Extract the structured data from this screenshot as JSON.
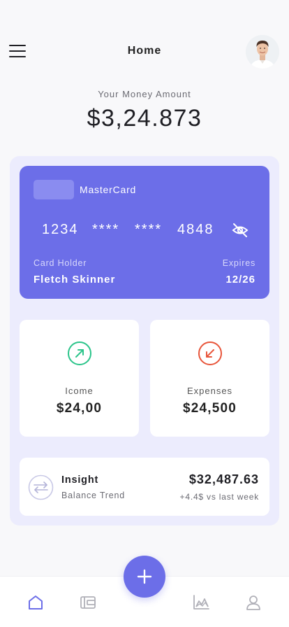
{
  "header": {
    "title": "Home"
  },
  "balance": {
    "label": "Your Money Amount",
    "value": "$3,24.873"
  },
  "card": {
    "brand": "MasterCard",
    "number_groups": [
      "1234",
      "****",
      "****",
      "4848"
    ],
    "holder_label": "Card Holder",
    "holder_name": "Fletch Skinner",
    "expires_label": "Expires",
    "expires_value": "12/26"
  },
  "income": {
    "label": "Icome",
    "value": "$24,00",
    "color": "#2bc48a"
  },
  "expenses": {
    "label": "Expenses",
    "value": "$24,500",
    "color": "#e8553a"
  },
  "insight": {
    "title": "Insight",
    "subtitle": "Balance Trend",
    "value": "$32,487.63",
    "change": "+4.4$ vs last week"
  },
  "nav": {
    "items": [
      "home-icon",
      "wallet-icon",
      "add-icon",
      "chart-icon",
      "profile-icon"
    ],
    "active": "home-icon"
  },
  "colors": {
    "accent": "#6c6ee8",
    "panel": "#ececfd",
    "background": "#f8f8fa"
  }
}
